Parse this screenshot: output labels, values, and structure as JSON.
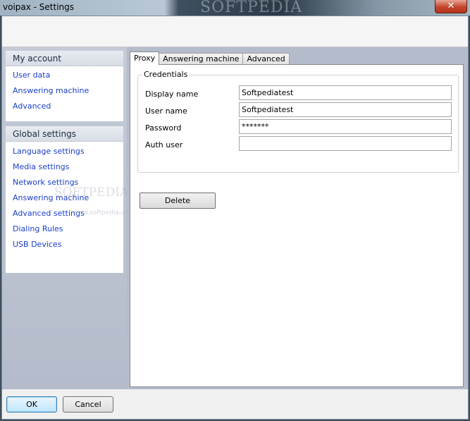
{
  "window": {
    "title": "voipax - Settings",
    "watermark": "SOFTPEDIA",
    "close_label": "✕"
  },
  "sidebar": {
    "my_account": {
      "header": "My account",
      "items": [
        "User data",
        "Answering machine",
        "Advanced"
      ]
    },
    "global_settings": {
      "header": "Global settings",
      "items": [
        "Language settings",
        "Media settings",
        "Network settings",
        "Answering machine",
        "Advanced settings",
        "Dialing Rules",
        "USB Devices"
      ]
    },
    "watermark": "SOFTPEDIA",
    "watermark_url": "www.softpedia.com"
  },
  "tabs": [
    {
      "label": "Proxy",
      "active": true
    },
    {
      "label": "Answering machine",
      "active": false
    },
    {
      "label": "Advanced",
      "active": false
    }
  ],
  "credentials": {
    "legend": "Credentials",
    "fields": [
      {
        "label": "Display name",
        "value": "Softpediatest"
      },
      {
        "label": "User name",
        "value": "Softpediatest"
      },
      {
        "label": "Password",
        "value": "*******"
      },
      {
        "label": "Auth user",
        "value": ""
      }
    ]
  },
  "delete_label": "Delete",
  "footer": {
    "ok_label": "OK",
    "cancel_label": "Cancel"
  }
}
